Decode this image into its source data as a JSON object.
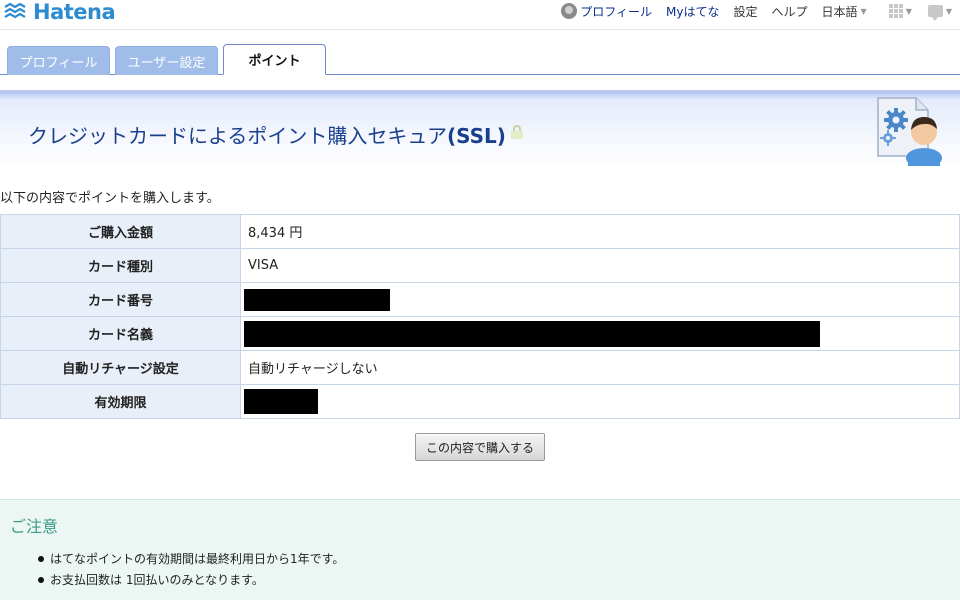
{
  "header": {
    "logo_text": "Hatena",
    "nav": [
      {
        "label": "プロフィール"
      },
      {
        "label": "Myはてな"
      },
      {
        "label": "設定"
      },
      {
        "label": "ヘルプ"
      },
      {
        "label": "日本語"
      }
    ],
    "icons": [
      "avatar-icon",
      "apps-grid-icon",
      "notification-bubble-icon"
    ]
  },
  "tabs": [
    {
      "label": "プロフィール",
      "active": false
    },
    {
      "label": "ユーザー設定",
      "active": false
    },
    {
      "label": "ポイント",
      "active": true
    }
  ],
  "page": {
    "title": "クレジットカードによるポイント購入セキュア",
    "title_suffix": "(SSL)",
    "intro": "以下の内容でポイントを購入します。"
  },
  "details": {
    "rows": [
      {
        "label": "ご購入金額",
        "value": "8,434 円",
        "redacted": false
      },
      {
        "label": "カード種別",
        "value": "VISA",
        "redacted": false
      },
      {
        "label": "カード番号",
        "value": "",
        "redacted": true
      },
      {
        "label": "カード名義",
        "value": "",
        "redacted": true
      },
      {
        "label": "自動リチャージ設定",
        "value": "自動リチャージしない",
        "redacted": false
      },
      {
        "label": "有効期限",
        "value": "",
        "redacted": true
      }
    ]
  },
  "actions": {
    "submit_label": "この内容で購入する"
  },
  "notice": {
    "title": "ご注意",
    "items": [
      "はてなポイントの有効期間は最終利用日から1年です。",
      "お支払回数は 1回払いのみとなります。"
    ]
  },
  "colors": {
    "brand": "#2d8ccf",
    "title": "#1a3f8c",
    "tab_inactive": "#9fbde8",
    "notice_bg": "#ecf6f3",
    "notice_title": "#3a9b87"
  }
}
